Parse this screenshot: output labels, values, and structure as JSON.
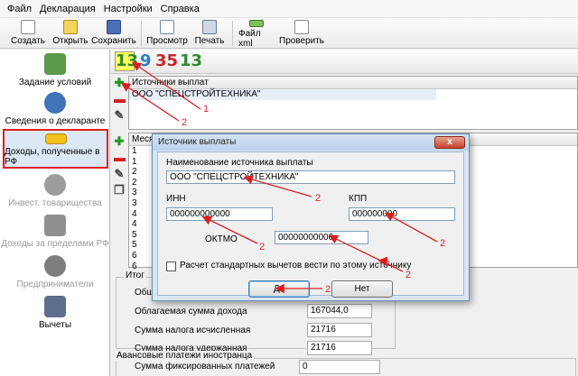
{
  "menu": [
    "Файл",
    "Декларация",
    "Настройки",
    "Справка"
  ],
  "toolbar": {
    "create": "Создать",
    "open": "Открыть",
    "save": "Сохранить",
    "preview": "Просмотр",
    "print": "Печать",
    "file_xml": "Файл xml",
    "check": "Проверить"
  },
  "nav": {
    "conditions": "Задание условий",
    "declarant": "Сведения о декларанте",
    "income_rf": "Доходы, полученные в РФ",
    "invest": "Инвест. товарищества",
    "income_abroad": "Доходы за пределами РФ",
    "entrepreneurs": "Предприниматели",
    "deductions": "Вычеты"
  },
  "tax_rates": [
    "13",
    "9",
    "35",
    "13"
  ],
  "sources": {
    "header": "Источники выплат",
    "rows": [
      "ООО \"СПЕЦСТРОЙТЕХНИКА\""
    ]
  },
  "income_grid": {
    "header": "Меся",
    "months": [
      "1",
      "1",
      "2",
      "2",
      "3",
      "3",
      "4",
      "4",
      "5",
      "5",
      "6",
      "6",
      "7"
    ]
  },
  "summary": {
    "group_label": "Итог",
    "rows": [
      {
        "label": "Обще",
        "value": ""
      },
      {
        "label": "Облагаемая сумма дохода",
        "value": "167044,0"
      },
      {
        "label": "Сумма налога исчисленная",
        "value": "21716"
      },
      {
        "label": "Сумма налога удержанная",
        "value": "21716"
      }
    ],
    "advance_label": "Авансовые платежи иностранца",
    "fixed_payments_label": "Сумма фиксированных платежей",
    "fixed_payments_value": "0"
  },
  "dialog": {
    "title": "Источник выплаты",
    "name_label": "Наименование источника выплаты",
    "name_value": "ООО \"СПЕЦСТРОЙТЕХНИКА\"",
    "inn_label": "ИНН",
    "inn_value": "000000000000",
    "kpp_label": "КПП",
    "kpp_value": "000000000",
    "oktmo_label": "ОКТМО",
    "oktmo_value": "00000000000",
    "checkbox_label": "Расчет стандартных вычетов вести по этому источнику",
    "ok_label": "Да",
    "cancel_label": "Нет",
    "close_label": "x"
  },
  "annotations": [
    "1",
    "2",
    "2",
    "2",
    "2",
    "2",
    "2",
    "2"
  ]
}
